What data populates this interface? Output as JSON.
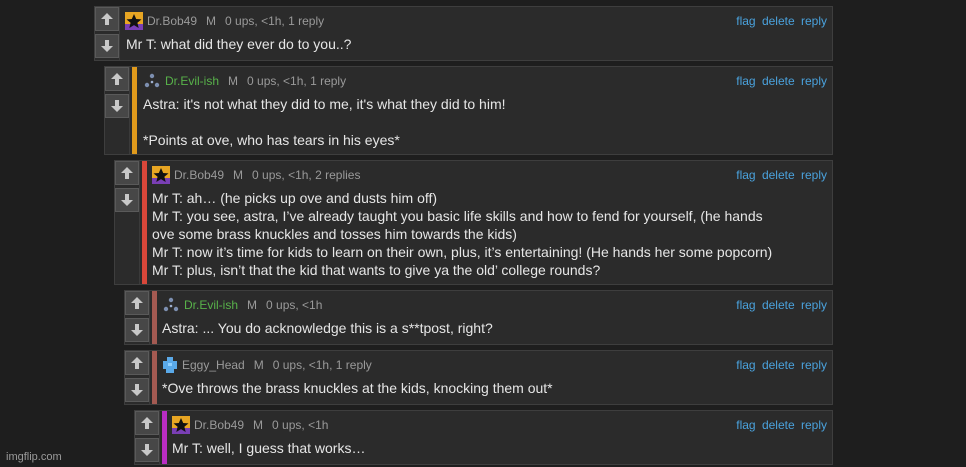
{
  "comments": [
    {
      "username": "Dr.Bob49",
      "avatar": "imgflip-star-avatar",
      "badge": "M",
      "meta": "0 ups, <1h, 1 reply",
      "lines": [
        "Mr T: what did they ever do to you..?"
      ]
    },
    {
      "username": "Dr.Evil-ish",
      "avatar": "triangle-dots-avatar",
      "badge": "M",
      "meta": "0 ups, <1h, 1 reply",
      "bar_color": "#e09a1c",
      "lines": [
        "Astra: it's not what they did to me, it's what they did to him!",
        "",
        "*Points at ove, who has tears in his eyes*"
      ]
    },
    {
      "username": "Dr.Bob49",
      "avatar": "imgflip-star-avatar",
      "badge": "M",
      "meta": "0 ups, <1h, 2 replies",
      "bar_color": "#d9473a",
      "lines": [
        "Mr T: ah… (he picks up ove and dusts him off)",
        "Mr T: you see, astra, I’ve already taught you basic life skills and how to fend for yourself, (he hands",
        "ove some brass knuckles and tosses him towards the kids)",
        "Mr T: now it’s time for kids to learn on their own, plus, it’s entertaining! (He hands her some popcorn)",
        "Mr T: plus, isn’t that the kid that wants to give ya the old’ college rounds?"
      ]
    },
    {
      "username": "Dr.Evil-ish",
      "avatar": "triangle-dots-avatar",
      "badge": "M",
      "meta": "0 ups, <1h",
      "bar_color": "#a45a52",
      "lines": [
        "Astra: ... You do acknowledge this is a s**tpost, right?"
      ]
    },
    {
      "username": "Eggy_Head",
      "avatar": "blue-pixel-avatar",
      "badge": "M",
      "meta": "0 ups, <1h, 1 reply",
      "bar_color": "#a45a52",
      "lines": [
        "*Ove throws the brass knuckles at the kids, knocking them out*"
      ]
    },
    {
      "username": "Dr.Bob49",
      "avatar": "imgflip-star-avatar",
      "badge": "M",
      "meta": "0 ups, <1h",
      "bar_color": "#b92dc4",
      "lines": [
        "Mr T: well, I guess that works…"
      ]
    }
  ],
  "actions": {
    "flag": "flag",
    "delete": "delete",
    "reply": "reply"
  },
  "icons": {
    "upvote": "up-arrow-icon",
    "downvote": "down-arrow-icon"
  },
  "colors": {
    "link": "#4aa2dd",
    "username_green": "#58b24a"
  },
  "watermark": "imgflip.com"
}
